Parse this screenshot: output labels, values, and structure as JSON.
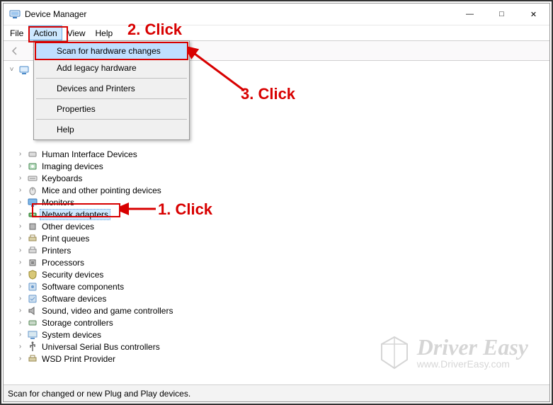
{
  "window": {
    "title": "Device Manager"
  },
  "win_controls": {
    "min": "—",
    "max": "□",
    "close": "✕"
  },
  "menubar": [
    "File",
    "Action",
    "View",
    "Help"
  ],
  "dropdown": {
    "items": [
      "Scan for hardware changes",
      "Add legacy hardware",
      "Devices and Printers",
      "Properties",
      "Help"
    ]
  },
  "tree": {
    "root": {
      "label": "",
      "expanded": true
    },
    "nodes": [
      {
        "label": "Human Interface Devices",
        "icon": "hid"
      },
      {
        "label": "Imaging devices",
        "icon": "imaging"
      },
      {
        "label": "Keyboards",
        "icon": "keyboard"
      },
      {
        "label": "Mice and other pointing devices",
        "icon": "mouse"
      },
      {
        "label": "Monitors",
        "icon": "monitor"
      },
      {
        "label": "Network adapters",
        "icon": "network",
        "selected": true
      },
      {
        "label": "Other devices",
        "icon": "other"
      },
      {
        "label": "Print queues",
        "icon": "printq"
      },
      {
        "label": "Printers",
        "icon": "printer"
      },
      {
        "label": "Processors",
        "icon": "cpu"
      },
      {
        "label": "Security devices",
        "icon": "security"
      },
      {
        "label": "Software components",
        "icon": "swc"
      },
      {
        "label": "Software devices",
        "icon": "swd"
      },
      {
        "label": "Sound, video and game controllers",
        "icon": "sound"
      },
      {
        "label": "Storage controllers",
        "icon": "storage"
      },
      {
        "label": "System devices",
        "icon": "system"
      },
      {
        "label": "Universal Serial Bus controllers",
        "icon": "usb"
      },
      {
        "label": "WSD Print Provider",
        "icon": "wsd"
      }
    ]
  },
  "statusbar": "Scan for changed or new Plug and Play devices.",
  "annotations": {
    "a1": "1. Click",
    "a2": "2. Click",
    "a3": "3. Click"
  },
  "watermark": {
    "brand": "Driver Easy",
    "url": "www.DriverEasy.com"
  }
}
